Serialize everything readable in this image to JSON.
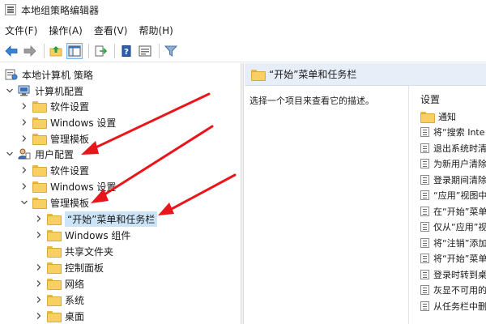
{
  "window": {
    "title": "本地组策略编辑器"
  },
  "menu": {
    "items": [
      "文件(F)",
      "操作(A)",
      "查看(V)",
      "帮助(H)"
    ]
  },
  "toolbar": {
    "icons": [
      "back-arrow-icon",
      "forward-arrow-icon",
      "up-folder-icon",
      "show-tree-icon",
      "export-list-icon",
      "help-icon",
      "properties-icon",
      "filter-icon"
    ]
  },
  "tree": {
    "nodes": [
      {
        "label": "本地计算机 策略",
        "level": 0,
        "chevron": "none",
        "icon": "policy"
      },
      {
        "label": "计算机配置",
        "level": 1,
        "chevron": "down",
        "icon": "computer"
      },
      {
        "label": "软件设置",
        "level": 2,
        "chevron": "right",
        "icon": "folder"
      },
      {
        "label": "Windows 设置",
        "level": 2,
        "chevron": "right",
        "icon": "folder"
      },
      {
        "label": "管理模板",
        "level": 2,
        "chevron": "right",
        "icon": "folder"
      },
      {
        "label": "用户配置",
        "level": 1,
        "chevron": "down",
        "icon": "user"
      },
      {
        "label": "软件设置",
        "level": 2,
        "chevron": "right",
        "icon": "folder"
      },
      {
        "label": "Windows 设置",
        "level": 2,
        "chevron": "right",
        "icon": "folder"
      },
      {
        "label": "管理模板",
        "level": 2,
        "chevron": "down",
        "icon": "folder"
      },
      {
        "label": "“开始”菜单和任务栏",
        "level": 3,
        "chevron": "right",
        "icon": "folder",
        "selected": true
      },
      {
        "label": "Windows 组件",
        "level": 3,
        "chevron": "right",
        "icon": "folder"
      },
      {
        "label": "共享文件夹",
        "level": 3,
        "chevron": "none",
        "icon": "folder"
      },
      {
        "label": "控制面板",
        "level": 3,
        "chevron": "right",
        "icon": "folder"
      },
      {
        "label": "网络",
        "level": 3,
        "chevron": "right",
        "icon": "folder"
      },
      {
        "label": "系统",
        "level": 3,
        "chevron": "right",
        "icon": "folder"
      },
      {
        "label": "桌面",
        "level": 3,
        "chevron": "right",
        "icon": "folder"
      }
    ]
  },
  "right_pane": {
    "header": "“开始”菜单和任务栏",
    "description": "选择一个项目来查看它的描述。",
    "column_header": "设置",
    "items": [
      {
        "label": "通知",
        "kind": "folder"
      },
      {
        "label": "将“搜索 Inte",
        "kind": "setting"
      },
      {
        "label": "退出系统时清",
        "kind": "setting"
      },
      {
        "label": "为新用户清除",
        "kind": "setting"
      },
      {
        "label": "登录期间清除",
        "kind": "setting"
      },
      {
        "label": "“应用”视图中",
        "kind": "setting"
      },
      {
        "label": "在“开始”菜单",
        "kind": "setting"
      },
      {
        "label": "仅从“应用”视",
        "kind": "setting"
      },
      {
        "label": "将“注销”添加",
        "kind": "setting"
      },
      {
        "label": "将“开始”菜单",
        "kind": "setting"
      },
      {
        "label": "登录时转到桌",
        "kind": "setting"
      },
      {
        "label": "灰显不可用的",
        "kind": "setting"
      },
      {
        "label": "从任务栏中删",
        "kind": "setting"
      }
    ]
  },
  "colors": {
    "arrow": "#e8161b",
    "selection": "#cce4f7",
    "header_bg": "#e8eef7",
    "folder": "#f7cf63"
  }
}
